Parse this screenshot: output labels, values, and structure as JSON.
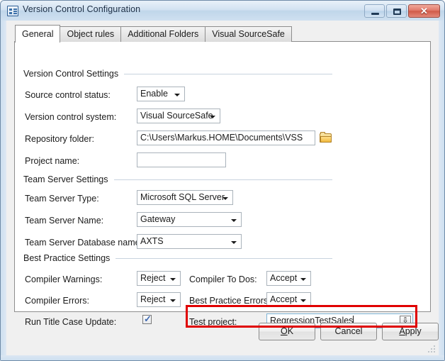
{
  "window": {
    "title": "Version Control Configuration",
    "icon": "form-properties-icon",
    "controls": {
      "minimize": "minimize-icon",
      "maximize": "maximize-icon",
      "close": "✕"
    }
  },
  "tabs": [
    {
      "label": "General",
      "active": true
    },
    {
      "label": "Object rules",
      "active": false
    },
    {
      "label": "Additional Folders",
      "active": false
    },
    {
      "label": "Visual SourceSafe",
      "active": false
    }
  ],
  "groups": {
    "version_control": "Version Control Settings",
    "team_server": "Team Server Settings",
    "best_practice": "Best Practice Settings"
  },
  "fields": {
    "source_control_status": {
      "label": "Source control status:",
      "value": "Enable"
    },
    "version_control_system": {
      "label": "Version control system:",
      "value": "Visual SourceSafe"
    },
    "repository_folder": {
      "label": "Repository folder:",
      "value": "C:\\Users\\Markus.HOME\\Documents\\VSS",
      "browse_icon": "folder-icon"
    },
    "project_name": {
      "label": "Project name:",
      "value": "",
      "placeholder": ""
    },
    "team_server_type": {
      "label": "Team Server Type:",
      "value": "Microsoft SQL Server"
    },
    "team_server_name": {
      "label": "Team Server Name:",
      "value": "Gateway"
    },
    "team_server_database_name": {
      "label": "Team Server Database name:",
      "value": "AXTS"
    },
    "compiler_warnings": {
      "label": "Compiler Warnings:",
      "value": "Reject"
    },
    "compiler_errors": {
      "label": "Compiler Errors:",
      "value": "Reject"
    },
    "run_title_case_update": {
      "label": "Run Title Case Update:",
      "checked": true,
      "check_glyph": "✓"
    },
    "compiler_to_dos": {
      "label": "Compiler To Dos:",
      "value": "Accept"
    },
    "best_practice_errors": {
      "label": "Best Practice Errors:",
      "value": "Accept"
    },
    "test_project": {
      "label": "Test project:",
      "value": "RegressionTestSales",
      "lookup_icon": "lookup-arrow-icon",
      "lookup_glyph": "⇩",
      "focused": true,
      "highlighted": true
    }
  },
  "buttons": {
    "ok": "OK",
    "ok_accel": "O",
    "ok_rest": "K",
    "cancel": "Cancel",
    "apply": "Apply",
    "apply_accel": "A",
    "apply_rest": "pply"
  },
  "colors": {
    "highlight": "#e00000",
    "focus_border": "#7eb4d6",
    "accent": "#3e68b0",
    "folder": "#f0b93c"
  }
}
